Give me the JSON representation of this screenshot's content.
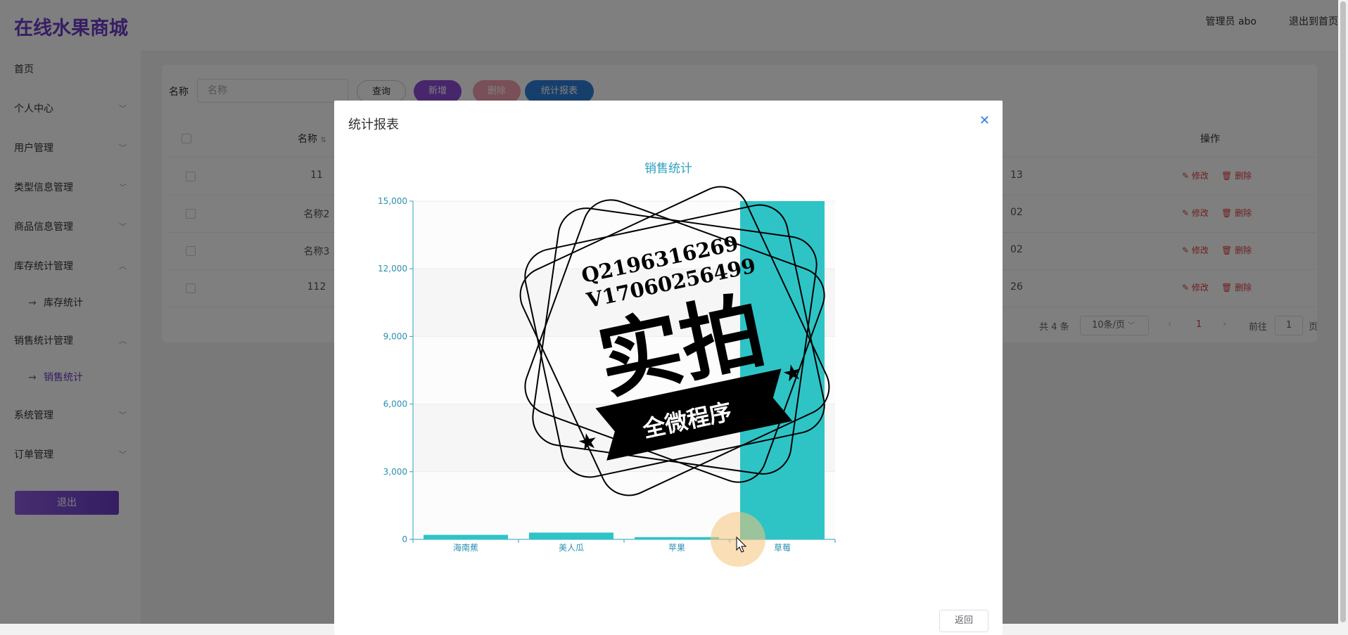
{
  "header": {
    "brand": "在线水果商城",
    "user": "管理员 abo",
    "logout_home": "退出到首页"
  },
  "sidebar": {
    "items": [
      {
        "label": "首页"
      },
      {
        "label": "个人中心"
      },
      {
        "label": "用户管理"
      },
      {
        "label": "类型信息管理"
      },
      {
        "label": "商品信息管理"
      },
      {
        "label": "库存统计管理"
      },
      {
        "label": "库存统计"
      },
      {
        "label": "销售统计管理"
      },
      {
        "label": "销售统计"
      },
      {
        "label": "系统管理"
      },
      {
        "label": "订单管理"
      }
    ],
    "logout_label": "退出"
  },
  "toolbar": {
    "name_label": "名称",
    "name_placeholder": "名称",
    "query": "查询",
    "add": "新增",
    "delete": "删除",
    "report": "统计报表"
  },
  "table": {
    "headers": {
      "name": "名称",
      "op": "操作"
    },
    "rows": [
      {
        "name": "11",
        "right": "13",
        "edit": "修改",
        "del": "删除"
      },
      {
        "name": "名称2",
        "right": "02",
        "edit": "修改",
        "del": "删除"
      },
      {
        "name": "名称3",
        "right": "02",
        "edit": "修改",
        "del": "删除"
      },
      {
        "name": "112",
        "right": "26",
        "edit": "修改",
        "del": "删除"
      }
    ]
  },
  "pagination": {
    "total": "共 4 条",
    "size": "10条/页",
    "current": "1",
    "goto": "前往",
    "jump": "1",
    "unit": "页"
  },
  "dialog": {
    "title": "统计报表",
    "back": "返回"
  },
  "watermark": {
    "line1": "Q2196316269",
    "line2": "V17060256499",
    "big": "实拍",
    "banner": "全微程序"
  },
  "chart_data": {
    "type": "bar",
    "title": "销售统计",
    "categories": [
      "海南蕉",
      "美人瓜",
      "苹果",
      "草莓"
    ],
    "values": [
      200,
      300,
      100,
      15000
    ],
    "yticks": [
      "0",
      "3,000",
      "6,000",
      "9,000",
      "12,000",
      "15,000"
    ],
    "ylim": [
      0,
      15000
    ],
    "grid": true,
    "color": "#2ec4c6"
  },
  "colors": {
    "brand": "#6a3cc6",
    "accent": "#2f7fd8",
    "danger": "#e04040"
  }
}
